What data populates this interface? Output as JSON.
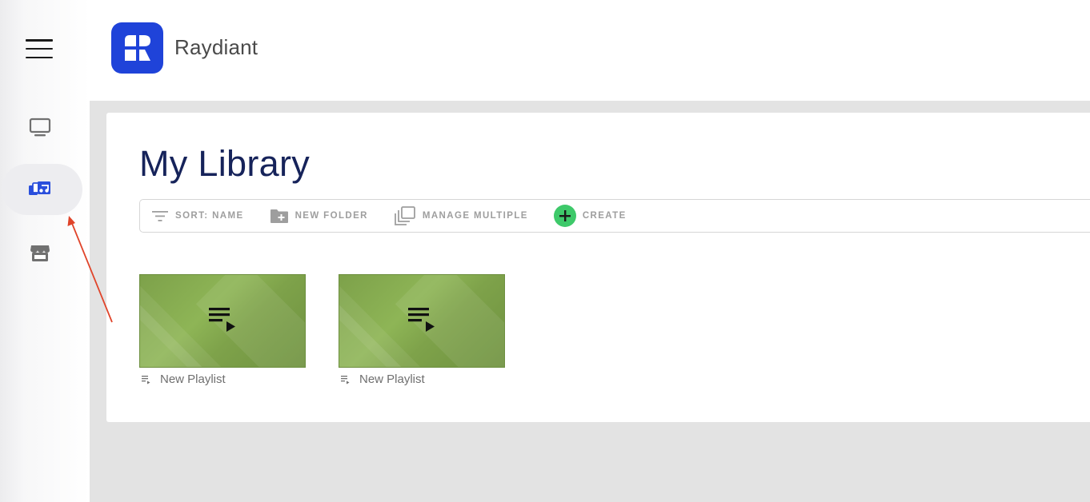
{
  "app": {
    "brand_name": "Raydiant",
    "brand_color": "#1f43d9"
  },
  "sidebar": {
    "menu_icon": "hamburger-icon",
    "items": [
      {
        "id": "displays",
        "icon": "monitor-icon",
        "active": false
      },
      {
        "id": "library",
        "icon": "media-library-icon",
        "active": true
      },
      {
        "id": "marketplace",
        "icon": "store-icon",
        "active": false
      }
    ],
    "active_accent": "#2a4fdc"
  },
  "main": {
    "title": "My Library",
    "title_color": "#16235a",
    "toolbar": {
      "sort_label": "SORT: NAME",
      "new_folder_label": "NEW FOLDER",
      "manage_multiple_label": "MANAGE MULTIPLE",
      "create_label": "CREATE",
      "create_color": "#3ec96a"
    },
    "items": [
      {
        "type": "playlist",
        "name": "New Playlist",
        "thumb_color": "#84a84e"
      },
      {
        "type": "playlist",
        "name": "New Playlist",
        "thumb_color": "#84a84e"
      }
    ]
  },
  "annotation": {
    "arrow_color": "#e0442a"
  }
}
